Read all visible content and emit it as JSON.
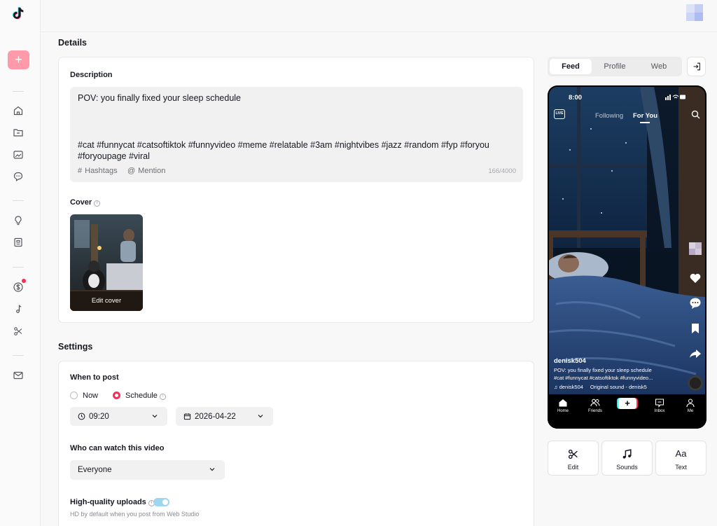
{
  "details": {
    "section_title": "Details",
    "description_label": "Description",
    "description_first_line": "POV: you finally fixed your sleep schedule",
    "description_tags": "#cat #funnycat #catsoftiktok #funnyvideo #meme #relatable #3am #nightvibes #jazz #random #fyp #foryou #foryoupage #viral",
    "hashtags_btn": "Hashtags",
    "mention_btn": "Mention",
    "char_counter": "166/4000",
    "cover_label": "Cover",
    "edit_cover": "Edit cover"
  },
  "settings": {
    "section_title": "Settings",
    "when_to_post": "When to post",
    "option_now": "Now",
    "option_schedule": "Schedule",
    "selected_option": "Schedule",
    "time_value": "09:20",
    "date_value": "2026-04-22",
    "who_can_watch_label": "Who can watch this video",
    "who_can_watch_value": "Everyone",
    "hq_label": "High-quality uploads",
    "hq_enabled": true,
    "hq_hint": "HD by default when you post from Web Studio"
  },
  "preview": {
    "tabs": [
      "Feed",
      "Profile",
      "Web"
    ],
    "active_tab": "Feed",
    "phone_time": "8:00",
    "phone_tab_following": "Following",
    "phone_tab_foryou": "For You",
    "live_badge": "LIVE",
    "username": "denisk504",
    "caption_line1": "POV: you finally fixed your sleep schedule",
    "caption_line2": "#cat #funnycat #catsoftiktok #funnyvideo...",
    "sound_user": "denisk504",
    "sound_text": "Original sound - denisk5",
    "nav": [
      "Home",
      "Friends",
      "",
      "Inbox",
      "Me"
    ]
  },
  "editor_tools": [
    {
      "label": "Edit",
      "icon": "scissors-icon"
    },
    {
      "label": "Sounds",
      "icon": "music-note-icon"
    },
    {
      "label": "Text",
      "icon": "text-aa-icon",
      "glyph": "Aa"
    }
  ],
  "colors": {
    "brand_red": "#fe2c55",
    "create_button": "#fe9aa9",
    "toggle_on": "#9ed6ef"
  }
}
